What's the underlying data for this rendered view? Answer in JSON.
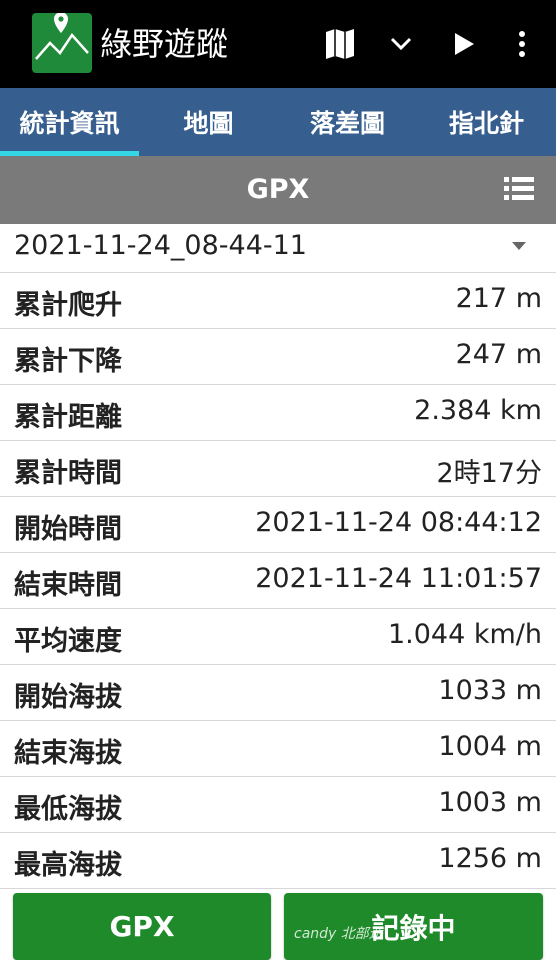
{
  "app": {
    "title": "綠野遊蹤"
  },
  "tabs": [
    {
      "label": "統計資訊",
      "active": true
    },
    {
      "label": "地圖",
      "active": false
    },
    {
      "label": "落差圖",
      "active": false
    },
    {
      "label": "指北針",
      "active": false
    }
  ],
  "section": {
    "title": "GPX"
  },
  "track": {
    "name": "2021-11-24_08-44-11"
  },
  "stats": [
    {
      "label": "累計爬升",
      "value": "217 m"
    },
    {
      "label": "累計下降",
      "value": "247 m"
    },
    {
      "label": "累計距離",
      "value": "2.384 km"
    },
    {
      "label": "累計時間",
      "value": "2時17分"
    },
    {
      "label": "開始時間",
      "value": "2021-11-24 08:44:12"
    },
    {
      "label": "結束時間",
      "value": "2021-11-24 11:01:57"
    },
    {
      "label": "平均速度",
      "value": "1.044 km/h"
    },
    {
      "label": "開始海拔",
      "value": "1033 m"
    },
    {
      "label": "結束海拔",
      "value": "1004 m"
    },
    {
      "label": "最低海拔",
      "value": "1003 m"
    },
    {
      "label": "最高海拔",
      "value": "1256 m"
    }
  ],
  "buttons": {
    "gpx_label": "GPX",
    "record_label": "記錄中"
  },
  "watermark": "candy 北部遊",
  "colors": {
    "appbar": "#000000",
    "tabs": "#365f8f",
    "tab_indicator": "#33d7e6",
    "gpx_bar": "#7a7a7a",
    "button": "#1e8a2a"
  },
  "icons": {
    "logo": "mountain-pin-icon",
    "map": "map-icon",
    "dropdown": "chevron-down-icon",
    "play": "play-icon",
    "more": "more-vert-icon",
    "list": "list-icon"
  }
}
